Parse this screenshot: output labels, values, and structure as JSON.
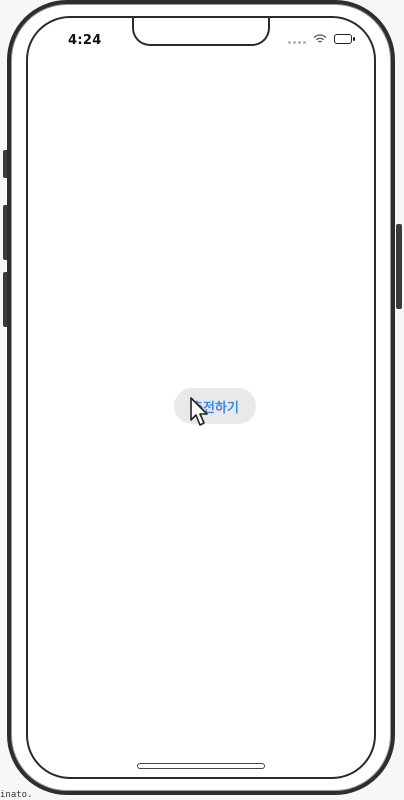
{
  "status_bar": {
    "time": "4:24",
    "icons": [
      "signal-icon",
      "wifi-icon",
      "battery-icon"
    ]
  },
  "main": {
    "charge_button_label": "충전하기"
  },
  "footer": {
    "text": "inato."
  },
  "colors": {
    "button_text": "#3b8ae6",
    "button_background": "#e9e9ec",
    "device_frame": "#2e2e2e"
  },
  "cursor": "arrow-cursor-icon"
}
